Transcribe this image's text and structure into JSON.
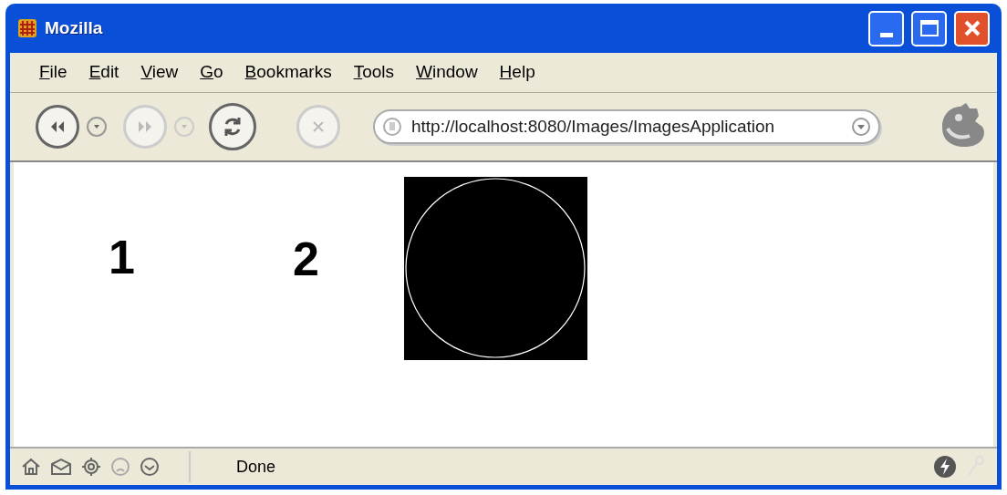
{
  "window": {
    "title": "Mozilla"
  },
  "menu": [
    "File",
    "Edit",
    "View",
    "Go",
    "Bookmarks",
    "Tools",
    "Window",
    "Help"
  ],
  "navigation": {
    "back_disabled": false,
    "forward_disabled": true,
    "stop_disabled": true
  },
  "address": {
    "value": "http://localhost:8080/Images/ImagesApplication"
  },
  "content": {
    "labels": [
      "1",
      "2"
    ]
  },
  "status_bar": {
    "text": "Done"
  }
}
